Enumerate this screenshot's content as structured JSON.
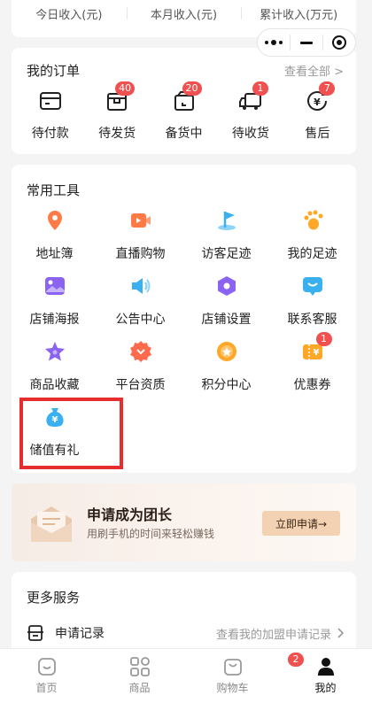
{
  "income": {
    "labels": [
      "今日收入(元)",
      "本月收入(元)",
      "累计收入(万元)"
    ]
  },
  "capsule": {
    "menu_icon": "more-dots-icon",
    "minimize_icon": "minus-icon",
    "close_icon": "target-icon"
  },
  "orders": {
    "title": "我的订单",
    "view_all": "查看全部 >",
    "items": [
      {
        "label": "待付款",
        "icon": "wallet-icon",
        "badge": ""
      },
      {
        "label": "待发货",
        "icon": "package-icon",
        "badge": "40"
      },
      {
        "label": "备货中",
        "icon": "box-icon",
        "badge": "20"
      },
      {
        "label": "待收货",
        "icon": "truck-icon",
        "badge": "1"
      },
      {
        "label": "售后",
        "icon": "after-sale-icon",
        "badge": "7"
      }
    ]
  },
  "tools": {
    "title": "常用工具",
    "items": [
      {
        "label": "地址簿",
        "icon": "location-pin-icon",
        "badge": ""
      },
      {
        "label": "直播购物",
        "icon": "live-video-icon",
        "badge": ""
      },
      {
        "label": "访客足迹",
        "icon": "flag-icon",
        "badge": ""
      },
      {
        "label": "我的足迹",
        "icon": "footprint-icon",
        "badge": ""
      },
      {
        "label": "店铺海报",
        "icon": "poster-icon",
        "badge": ""
      },
      {
        "label": "公告中心",
        "icon": "speaker-icon",
        "badge": ""
      },
      {
        "label": "店铺设置",
        "icon": "hexagon-settings-icon",
        "badge": ""
      },
      {
        "label": "联系客服",
        "icon": "chat-icon",
        "badge": ""
      },
      {
        "label": "商品收藏",
        "icon": "star-icon",
        "badge": ""
      },
      {
        "label": "平台资质",
        "icon": "certificate-icon",
        "badge": ""
      },
      {
        "label": "积分中心",
        "icon": "points-icon",
        "badge": ""
      },
      {
        "label": "优惠券",
        "icon": "coupon-icon",
        "badge": "1"
      },
      {
        "label": "储值有礼",
        "icon": "money-bag-icon",
        "badge": ""
      }
    ]
  },
  "banner": {
    "title": "申请成为团长",
    "subtitle": "用刷手机的时间来轻松赚钱",
    "button": "立即申请→"
  },
  "more": {
    "title": "更多服务",
    "item_label": "申请记录",
    "item_link": "查看我的加盟申请记录"
  },
  "tabbar": {
    "items": [
      {
        "label": "首页",
        "icon": "home-icon",
        "badge": ""
      },
      {
        "label": "商品",
        "icon": "grid-icon",
        "badge": ""
      },
      {
        "label": "购物车",
        "icon": "cart-icon",
        "badge": "2"
      },
      {
        "label": "我的",
        "icon": "user-icon",
        "badge": ""
      }
    ],
    "active_index": 3
  },
  "colors": {
    "accent_orange": "#ff7a45",
    "accent_blue": "#3ab0f0",
    "accent_purple": "#8a63f0",
    "badge_red": "#f0504f",
    "highlight_red": "#e62e2e"
  }
}
